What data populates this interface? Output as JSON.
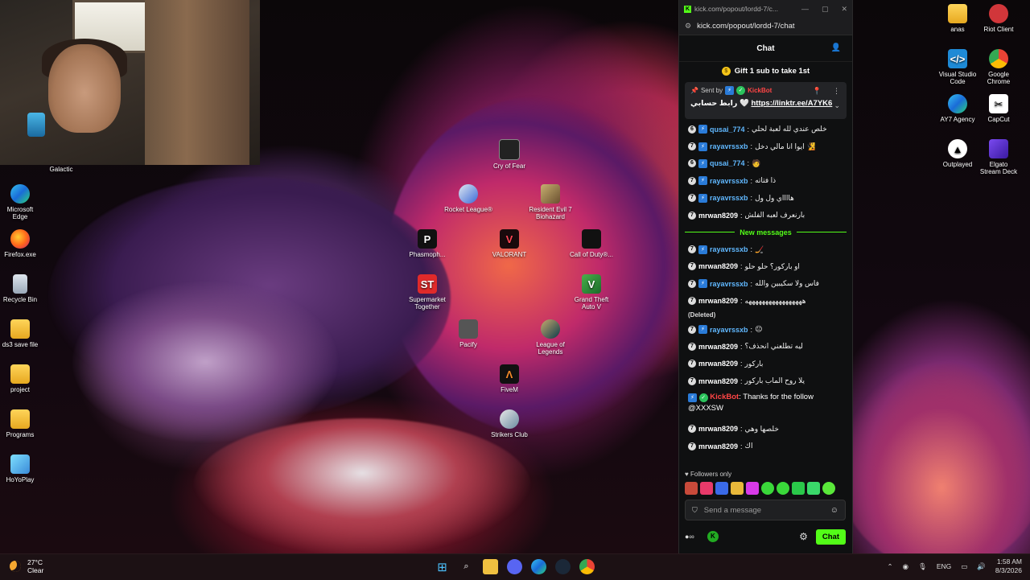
{
  "webcam": {
    "label": "Galactic"
  },
  "desktop_left": [
    {
      "label": "Microsoft Edge",
      "icon": "edge-icon"
    },
    {
      "label": "Firefox.exe",
      "icon": "firefox-icon"
    },
    {
      "label": "Recycle Bin",
      "icon": "recycle-bin-icon"
    },
    {
      "label": "ds3 save file",
      "icon": "folder-icon"
    },
    {
      "label": "project",
      "icon": "folder-icon"
    },
    {
      "label": "Programs",
      "icon": "folder-icon"
    },
    {
      "label": "HoYoPlay",
      "icon": "hoyoplay-icon"
    }
  ],
  "desktop_center": [
    {
      "label": "Cry of Fear",
      "icon": "cry-of-fear-icon"
    },
    {
      "label": "Rocket League®",
      "icon": "rocket-league-icon"
    },
    {
      "label": "Resident Evil 7 Biohazard",
      "icon": "resident-evil-icon"
    },
    {
      "label": "Phasmoph...",
      "icon": "phasmophobia-icon"
    },
    {
      "label": "VALORANT",
      "icon": "valorant-icon"
    },
    {
      "label": "Call of Duty®...",
      "icon": "call-of-duty-icon"
    },
    {
      "label": "Supermarket Together",
      "icon": "supermarket-icon"
    },
    {
      "label": "Grand Theft Auto V",
      "icon": "gta-icon"
    },
    {
      "label": "Pacify",
      "icon": "pacify-icon"
    },
    {
      "label": "League of Legends",
      "icon": "league-icon"
    },
    {
      "label": "FiveM",
      "icon": "fivem-icon"
    },
    {
      "label": "Strikers Club",
      "icon": "strikers-club-icon"
    }
  ],
  "desktop_right": [
    {
      "label": "anas",
      "icon": "folder-icon"
    },
    {
      "label": "Riot Client",
      "icon": "riot-client-icon"
    },
    {
      "label": "Visual Studio Code",
      "icon": "vscode-icon"
    },
    {
      "label": "Google Chrome",
      "icon": "chrome-icon"
    },
    {
      "label": "AY7 Agency",
      "icon": "edge-icon"
    },
    {
      "label": "CapCut",
      "icon": "capcut-icon"
    },
    {
      "label": "Outplayed",
      "icon": "outplayed-icon"
    },
    {
      "label": "Elgato Stream Deck",
      "icon": "stream-deck-icon"
    }
  ],
  "chat": {
    "window_title": "kick.com/popout/lordd-7/c...",
    "url": "kick.com/popout/lordd-7/chat",
    "header": "Chat",
    "gift": "Gift 1 sub to take 1st",
    "pinned": {
      "sent_by": "Sent by",
      "sender": "KickBot",
      "text_ar": "رابط حسابي 🤍",
      "link": "https://linktr.ee/A7YK6"
    },
    "messages_top": [
      {
        "level": "6",
        "name": "qusai_774",
        "text": "خلص عندي لله لعبة لحلي",
        "color": "c-blue"
      },
      {
        "level": "7",
        "name": "rayavrssxb",
        "text": "ايوا انا مالي دخل 🧏",
        "color": "c-blue"
      },
      {
        "level": "6",
        "name": "qusai_774",
        "text": "🧑",
        "color": "c-blue"
      },
      {
        "level": "7",
        "name": "rayavrssxb",
        "text": "ذا فتاته",
        "color": "c-blue"
      },
      {
        "level": "7",
        "name": "rayavrssxb",
        "text": "هااااي ول ول",
        "color": "c-blue"
      },
      {
        "level": "7",
        "name": "mrwan8209",
        "text": "بارنعرف لعبه الفلش",
        "color": "c-white"
      }
    ],
    "new_messages": "New messages",
    "messages_new": [
      {
        "level": "7",
        "name": "rayavrssxb",
        "text": "🏒",
        "color": "c-blue"
      },
      {
        "level": "7",
        "name": "mrwan8209",
        "text": "او باركور؟ حلو حلو",
        "color": "c-white"
      },
      {
        "level": "7",
        "name": "rayavrssxb",
        "text": "فاس ولا سكيبين والله",
        "color": "c-blue"
      },
      {
        "level": "7",
        "name": "mrwan8209",
        "text": "هههههههههههههههههه",
        "color": "c-white"
      }
    ],
    "deleted": "(Deleted)",
    "messages_after": [
      {
        "level": "7",
        "name": "rayavrssxb",
        "text": "😐",
        "color": "c-blue"
      },
      {
        "level": "7",
        "name": "mrwan8209",
        "text": "ليه تطلعني انحذف؟",
        "color": "c-white"
      },
      {
        "level": "7",
        "name": "mrwan8209",
        "text": "باركور",
        "color": "c-white"
      },
      {
        "level": "7",
        "name": "mrwan8209",
        "text": "يلا روح الماب باركور",
        "color": "c-white"
      }
    ],
    "bot_message": {
      "name": "KickBot",
      "text": "Thanks for the follow @XXXSW"
    },
    "messages_end": [
      {
        "level": "7",
        "name": "mrwan8209",
        "text": "خلصها وهي",
        "color": "c-white"
      },
      {
        "level": "7",
        "name": "mrwan8209",
        "text": "اك",
        "color": "c-white"
      }
    ],
    "followers_only": "Followers only",
    "placeholder": "Send a message",
    "send_button": "Chat"
  },
  "taskbar": {
    "temperature": "27°C",
    "weather": "Clear",
    "lang": "ENG",
    "time": "1:58 AM",
    "date": "8/3/2026"
  }
}
